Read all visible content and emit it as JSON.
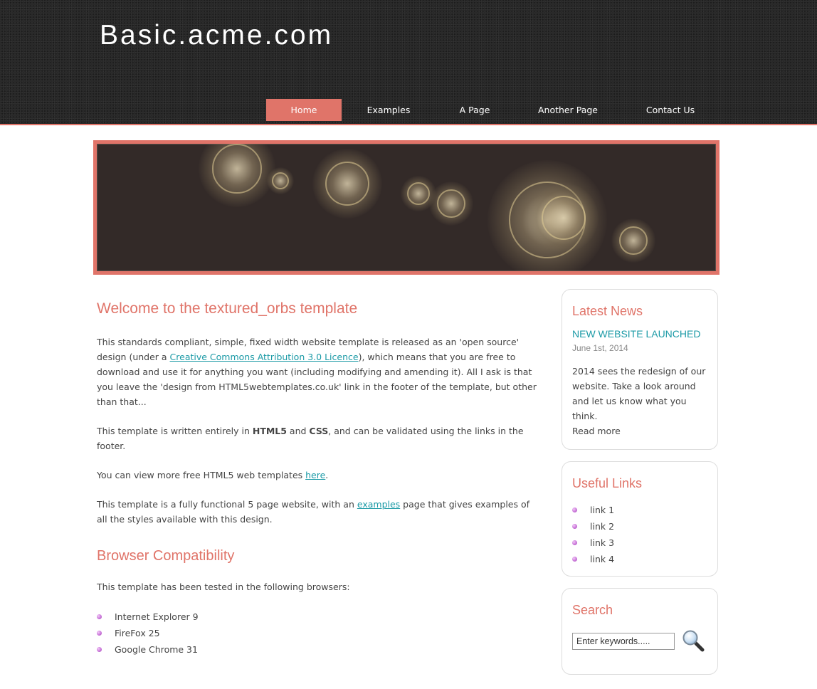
{
  "site": {
    "title": "Basic.acme.com"
  },
  "nav": [
    {
      "label": "Home",
      "active": true
    },
    {
      "label": "Examples",
      "active": false
    },
    {
      "label": "A Page",
      "active": false
    },
    {
      "label": "Another Page",
      "active": false
    },
    {
      "label": "Contact Us",
      "active": false
    }
  ],
  "colors": {
    "accent": "#e07469",
    "link": "#1b9aa6",
    "header_bg": "#262626",
    "banner_bg": "#332a28"
  },
  "main": {
    "heading": "Welcome to the textured_orbs template",
    "p1_before": "This standards compliant, simple, fixed width website template is released as an 'open source' design (under a ",
    "p1_link": "Creative Commons Attribution 3.0 Licence",
    "p1_after": "), which means that you are free to download and use it for anything you want (including modifying and amending it). All I ask is that you leave the 'design from HTML5webtemplates.co.uk' link in the footer of the template, but other than that...",
    "p2_before": "This template is written entirely in ",
    "p2_strong1": "HTML5",
    "p2_mid": " and ",
    "p2_strong2": "CSS",
    "p2_after": ", and can be validated using the links in the footer.",
    "p3_before": "You can view more free HTML5 web templates ",
    "p3_link": "here",
    "p3_after": ".",
    "p4_before": "This template is a fully functional 5 page website, with an ",
    "p4_link": "examples",
    "p4_after": " page that gives examples of all the styles available with this design.",
    "compat_heading": "Browser Compatibility",
    "compat_text": "This template has been tested in the following browsers:",
    "browsers": [
      "Internet Explorer 9",
      "FireFox 25",
      "Google Chrome 31"
    ]
  },
  "sidebar": {
    "news": {
      "heading": "Latest News",
      "title": "New Website Launched",
      "date": "June 1st, 2014",
      "text": "2014 sees the redesign of our website. Take a look around and let us know what you think.",
      "read_more": "Read more"
    },
    "links": {
      "heading": "Useful Links",
      "items": [
        "link 1",
        "link 2",
        "link 3",
        "link 4"
      ]
    },
    "search": {
      "heading": "Search",
      "input_value": "Enter keywords.....",
      "button_icon": "magnifier-icon"
    }
  }
}
